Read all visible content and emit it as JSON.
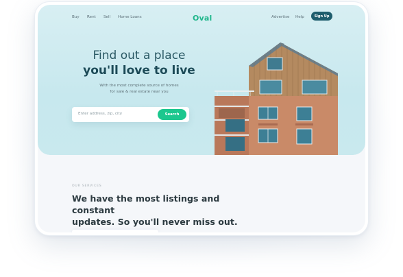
{
  "nav": {
    "left_links": [
      "Buy",
      "Rent",
      "Sell",
      "Home Loans"
    ],
    "logo": "Oval",
    "right_links": [
      "Advertise",
      "Help"
    ],
    "signup_label": "Sign Up"
  },
  "hero": {
    "title_line1": "Find out a place",
    "title_line2": "you'll love to live",
    "subtitle_line1": "With the most complete source of homes",
    "subtitle_line2": "for sale & real estate near you",
    "search": {
      "placeholder": "Enter address, zip, city",
      "button_label": "Search"
    }
  },
  "services": {
    "label": "OUR SERVICES",
    "title_line1": "We have the most listings and constant",
    "title_line2": "updates. So you'll never miss out."
  },
  "colors": {
    "brand": "#1fb68b",
    "primary_dark": "#1f5d6d",
    "search_button": "#1cc78e",
    "hero_bg": "#c9e9ee"
  }
}
